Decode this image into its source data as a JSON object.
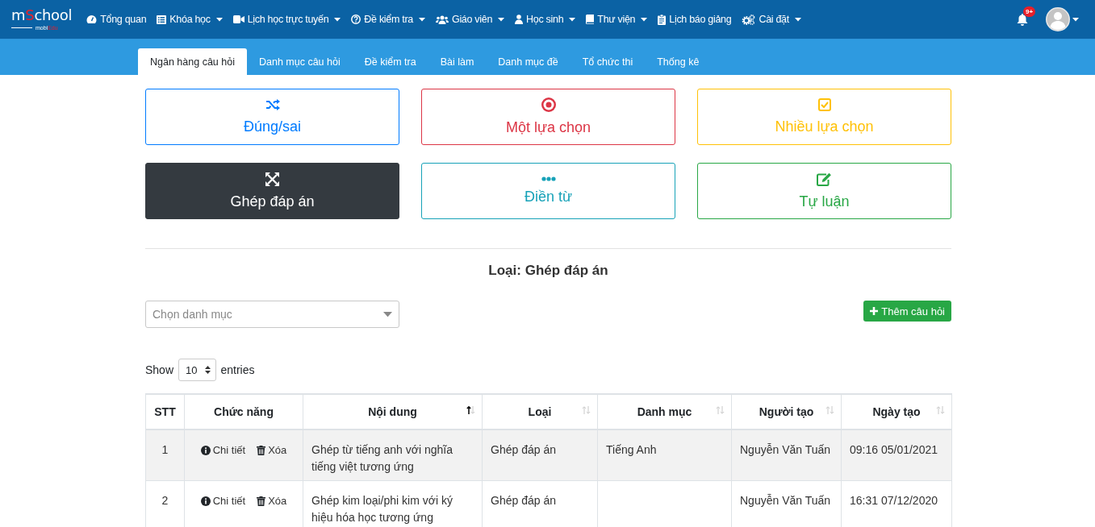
{
  "navbar": {
    "logo": [
      {
        "text": "m",
        "accent": false
      },
      {
        "text": "S",
        "accent": true
      },
      {
        "text": "chool",
        "accent": false
      }
    ],
    "logo_sub": [
      {
        "text": "mobi",
        "accent": false
      },
      {
        "text": "Edu",
        "accent": true
      }
    ],
    "menu": [
      {
        "label": "Tổng quan",
        "kind": "dashboard",
        "dropdown": false
      },
      {
        "label": "Khóa học",
        "kind": "list",
        "dropdown": true
      },
      {
        "label": "Lịch học trực tuyến",
        "kind": "video",
        "dropdown": true
      },
      {
        "label": "Đề kiểm tra",
        "kind": "question",
        "dropdown": true
      },
      {
        "label": "Giáo viên",
        "kind": "users",
        "dropdown": true
      },
      {
        "label": "Học sinh",
        "kind": "user",
        "dropdown": true
      },
      {
        "label": "Thư viện",
        "kind": "book",
        "dropdown": true
      },
      {
        "label": "Lịch báo giảng",
        "kind": "clipboard",
        "dropdown": false
      },
      {
        "label": "Cài đặt",
        "kind": "cogs",
        "dropdown": true
      }
    ],
    "notification_badge": "9+"
  },
  "tabs": [
    {
      "label": "Ngân hàng câu hỏi",
      "selected": true
    },
    {
      "label": "Danh mục câu hỏi",
      "selected": false
    },
    {
      "label": "Đề kiểm tra",
      "selected": false
    },
    {
      "label": "Bài làm",
      "selected": false
    },
    {
      "label": "Danh mục đề",
      "selected": false
    },
    {
      "label": "Tổ chức thi",
      "selected": false
    },
    {
      "label": "Thống kê",
      "selected": false
    }
  ],
  "question_types": [
    {
      "label": "Đúng/sai",
      "kind": "shuffle",
      "color": "#007bff",
      "selected": false
    },
    {
      "label": "Một lựa chọn",
      "kind": "radio",
      "color": "#dc3545",
      "selected": false
    },
    {
      "label": "Nhiều lựa chọn",
      "kind": "checkbox",
      "color": "#ffc107",
      "selected": false
    },
    {
      "label": "Ghép đáp án",
      "kind": "expand",
      "color": "#343a40",
      "selected": true
    },
    {
      "label": "Điền từ",
      "kind": "ellipsis",
      "color": "#17a2b8",
      "selected": false
    },
    {
      "label": "Tự luận",
      "kind": "edit",
      "color": "#28a745",
      "selected": false
    }
  ],
  "type_heading": "Loại: Ghép đáp án",
  "category_select": {
    "placeholder": "Chọn danh mục"
  },
  "add_button": "Thêm câu hỏi",
  "page_length": {
    "before": "Show",
    "value": "10",
    "after": "entries"
  },
  "table": {
    "columns": [
      {
        "label": "STT",
        "sortable": false
      },
      {
        "label": "Chức năng",
        "sortable": false
      },
      {
        "label": "Nội dung",
        "sortable": true,
        "sorted": true
      },
      {
        "label": "Loại",
        "sortable": true,
        "sorted": false
      },
      {
        "label": "Danh mục",
        "sortable": true,
        "sorted": false
      },
      {
        "label": "Người tạo",
        "sortable": true,
        "sorted": false
      },
      {
        "label": "Ngày tạo",
        "sortable": true,
        "sorted": false
      }
    ],
    "rows": [
      {
        "stt": "1",
        "actions": [
          "Chi tiết",
          "Xóa"
        ],
        "content": "Ghép từ tiếng anh với nghĩa tiếng việt tương ứng",
        "type": "Ghép đáp án",
        "category": "Tiếng Anh",
        "creator": "Nguyễn Văn Tuấn",
        "created": "09:16 05/01/2021"
      },
      {
        "stt": "2",
        "actions": [
          "Chi tiết",
          "Xóa"
        ],
        "content": "Ghép kim loại/phi kim với ký hiệu hóa học tương ứng",
        "type": "Ghép đáp án",
        "creator": "Nguyễn Văn Tuấn",
        "created": "16:31 07/12/2020"
      }
    ]
  }
}
